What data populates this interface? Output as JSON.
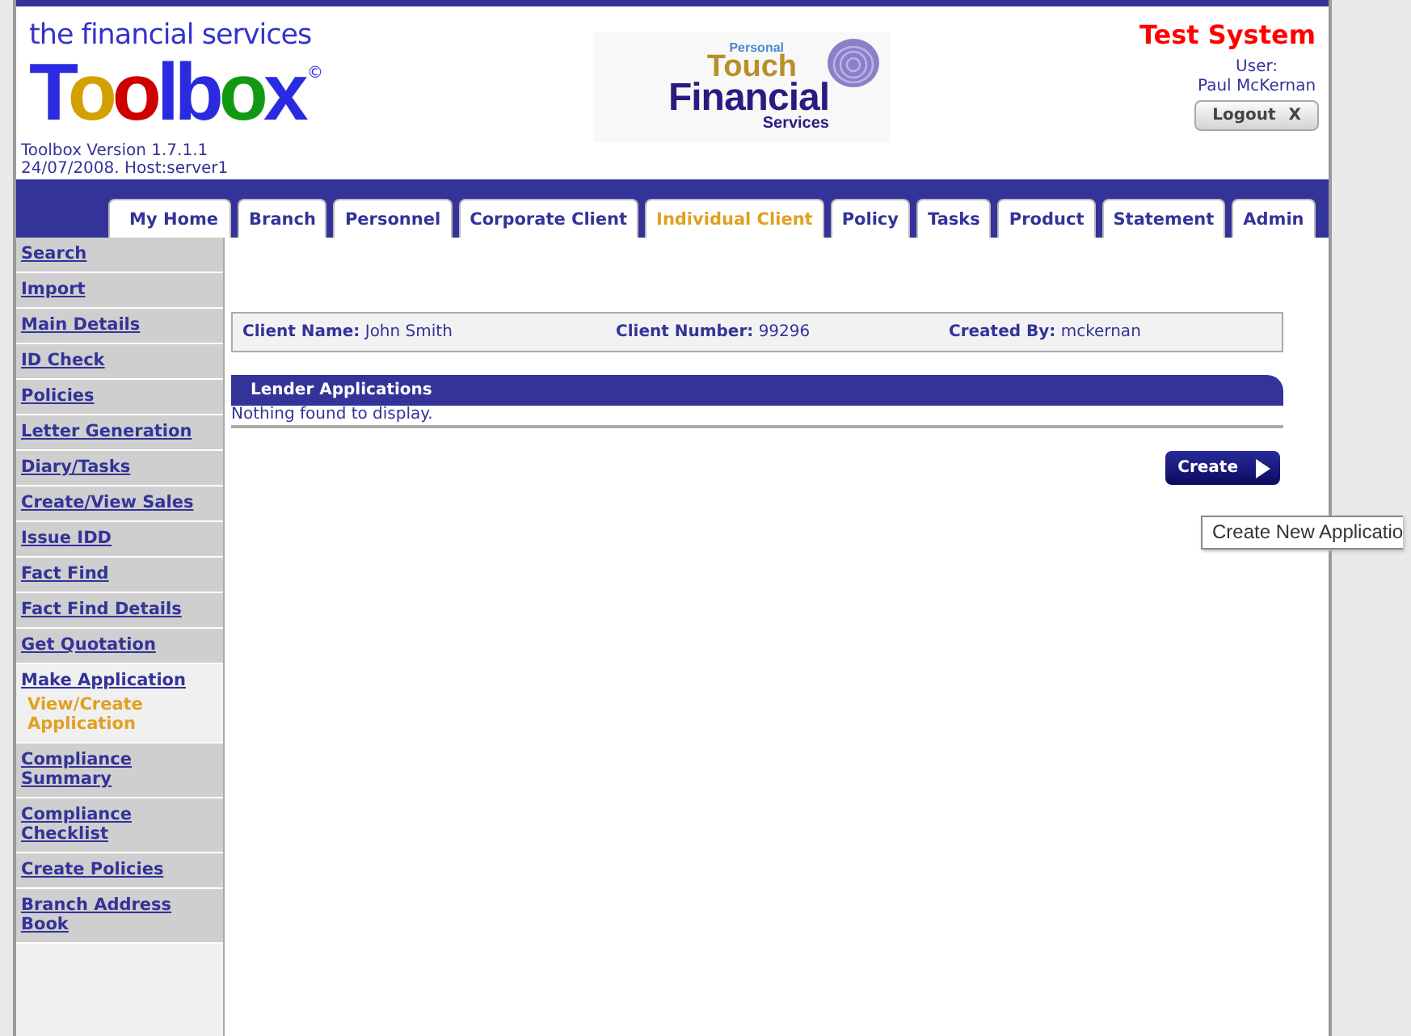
{
  "header": {
    "tagline": "the financial services",
    "logo_word": "Toolbox",
    "copyright": "©",
    "version": "Toolbox Version 1.7.1.1",
    "date_host": "24/07/2008. Host:server1",
    "partner": {
      "line1": "Personal",
      "line2": "Touch",
      "line3": "Financial",
      "line4": "Services"
    },
    "system": "Test System",
    "user_label": "User:",
    "user_name": "Paul McKernan",
    "logout": "Logout",
    "logout_icon": "X"
  },
  "tabs": [
    {
      "label": "My Home",
      "selected": false
    },
    {
      "label": "Branch",
      "selected": false
    },
    {
      "label": "Personnel",
      "selected": false
    },
    {
      "label": "Corporate Client",
      "selected": false
    },
    {
      "label": "Individual Client",
      "selected": true
    },
    {
      "label": "Policy",
      "selected": false
    },
    {
      "label": "Tasks",
      "selected": false
    },
    {
      "label": "Product",
      "selected": false
    },
    {
      "label": "Statement",
      "selected": false
    },
    {
      "label": "Admin",
      "selected": false
    }
  ],
  "sidebar": {
    "items": [
      {
        "label": "Search",
        "selected": false
      },
      {
        "label": "Import",
        "selected": false
      },
      {
        "label": "Main Details",
        "selected": false
      },
      {
        "label": "ID Check",
        "selected": false
      },
      {
        "label": "Policies",
        "selected": false
      },
      {
        "label": "Letter Generation",
        "selected": false
      },
      {
        "label": "Diary/Tasks",
        "selected": false
      },
      {
        "label": "Create/View Sales",
        "selected": false
      },
      {
        "label": "Issue IDD",
        "selected": false
      },
      {
        "label": "Fact Find",
        "selected": false
      },
      {
        "label": "Fact Find Details",
        "selected": false
      },
      {
        "label": "Get Quotation",
        "selected": false
      },
      {
        "label": "Make Application",
        "selected": true,
        "children": [
          {
            "label": "View/Create Application",
            "selected": true
          }
        ]
      },
      {
        "label": "Compliance Summary",
        "selected": false
      },
      {
        "label": "Compliance Checklist",
        "selected": false
      },
      {
        "label": "Create Policies",
        "selected": false
      },
      {
        "label": "Branch Address Book",
        "selected": false
      }
    ]
  },
  "client": [
    {
      "label": "Client Name:",
      "value": "John Smith"
    },
    {
      "label": "Client Number:",
      "value": "99296"
    },
    {
      "label": "Created By:",
      "value": "mckernan"
    }
  ],
  "panel": {
    "title": "Lender Applications",
    "empty": "Nothing found to display."
  },
  "create_button": "Create",
  "tooltip": "Create New Applicatio"
}
